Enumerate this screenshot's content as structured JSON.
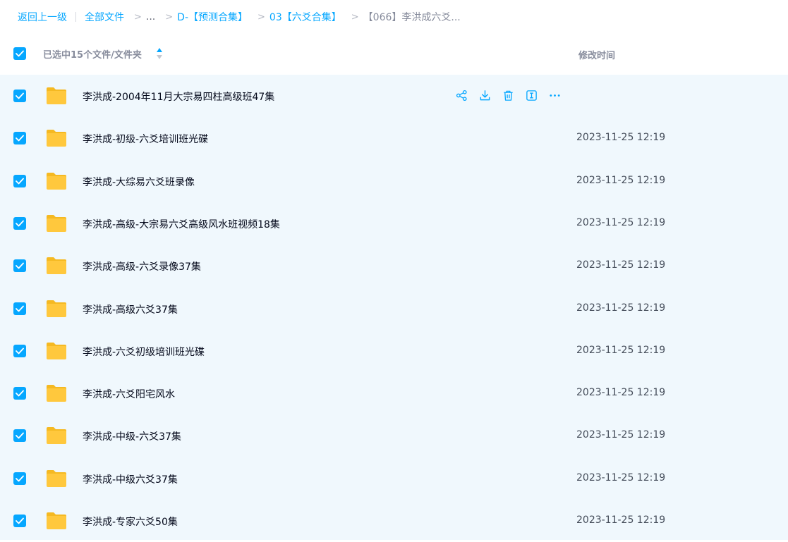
{
  "breadcrumb": {
    "back": "返回上一级",
    "all_files": "全部文件",
    "ellipsis": "...",
    "level1": "D-【预测合集】",
    "level2": "03【六爻合集】",
    "current": "【066】李洪成六爻..."
  },
  "header": {
    "selected_label": "已选中15个文件/文件夹",
    "modified_label": "修改时间",
    "checked": true
  },
  "colors": {
    "accent": "#06a7ff",
    "list_background": "#f0f8fd",
    "folder": "#ffc83d"
  },
  "row_actions": [
    "share-icon",
    "download-icon",
    "delete-icon",
    "rename-icon",
    "more-icon"
  ],
  "files": [
    {
      "name": "李洪成-2004年11月大宗易四柱高级班47集",
      "modified": "",
      "checked": true,
      "hovered": true
    },
    {
      "name": "李洪成-初级-六爻培训班光碟",
      "modified": "2023-11-25 12:19",
      "checked": true
    },
    {
      "name": "李洪成-大综易六爻班录像",
      "modified": "2023-11-25 12:19",
      "checked": true
    },
    {
      "name": "李洪成-高级-大宗易六爻高级风水班视频18集",
      "modified": "2023-11-25 12:19",
      "checked": true
    },
    {
      "name": "李洪成-高级-六爻录像37集",
      "modified": "2023-11-25 12:19",
      "checked": true
    },
    {
      "name": "李洪成-高级六爻37集",
      "modified": "2023-11-25 12:19",
      "checked": true
    },
    {
      "name": "李洪成-六爻初级培训班光碟",
      "modified": "2023-11-25 12:19",
      "checked": true
    },
    {
      "name": "李洪成-六爻阳宅风水",
      "modified": "2023-11-25 12:19",
      "checked": true
    },
    {
      "name": "李洪成-中级-六爻37集",
      "modified": "2023-11-25 12:19",
      "checked": true
    },
    {
      "name": "李洪成-中级六爻37集",
      "modified": "2023-11-25 12:19",
      "checked": true
    },
    {
      "name": "李洪成-专家六爻50集",
      "modified": "2023-11-25 12:19",
      "checked": true
    }
  ]
}
